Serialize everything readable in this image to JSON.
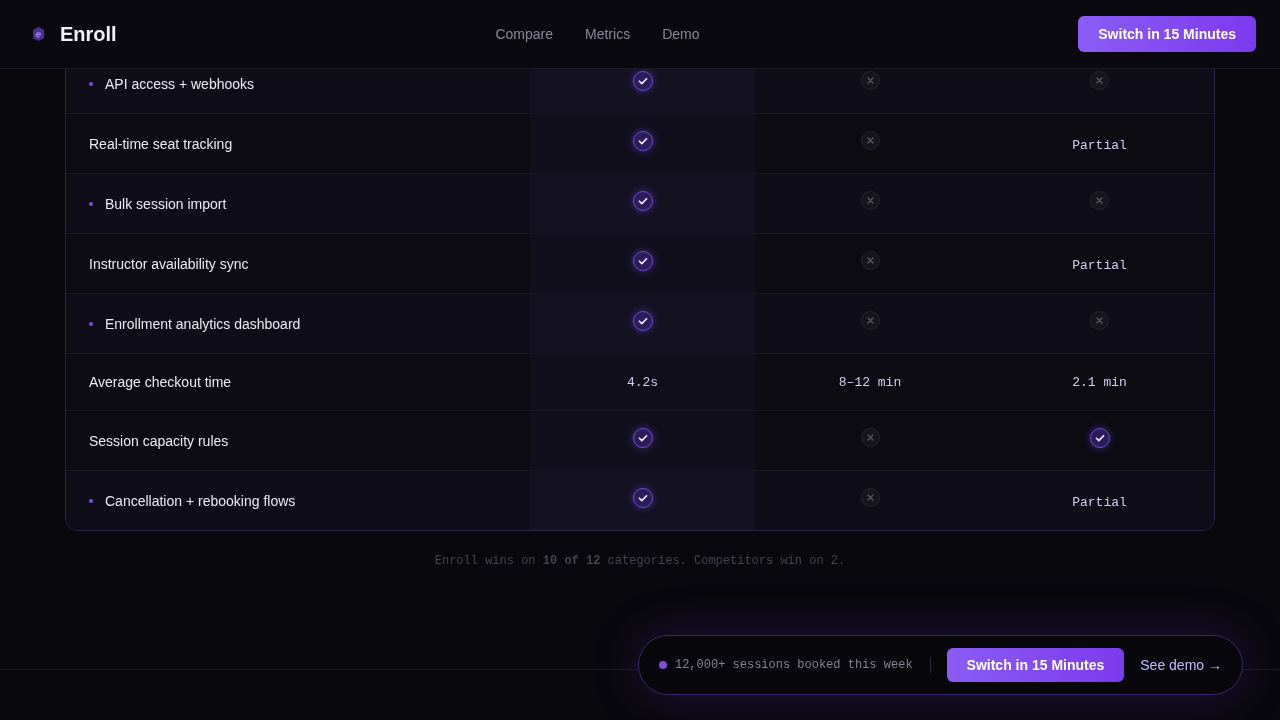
{
  "header": {
    "brand": "Enroll",
    "nav": [
      {
        "label": "Compare"
      },
      {
        "label": "Metrics"
      },
      {
        "label": "Demo"
      }
    ],
    "cta": "Switch in 15 Minutes"
  },
  "table": {
    "rows": [
      {
        "feature": "API access + webhooks",
        "highlighted": true,
        "cells": [
          {
            "kind": "check"
          },
          {
            "kind": "cross"
          },
          {
            "kind": "cross"
          }
        ]
      },
      {
        "feature": "Real-time seat tracking",
        "highlighted": false,
        "cells": [
          {
            "kind": "check"
          },
          {
            "kind": "cross"
          },
          {
            "kind": "text",
            "text": "Partial"
          }
        ]
      },
      {
        "feature": "Bulk session import",
        "highlighted": true,
        "cells": [
          {
            "kind": "check"
          },
          {
            "kind": "cross"
          },
          {
            "kind": "cross"
          }
        ]
      },
      {
        "feature": "Instructor availability sync",
        "highlighted": false,
        "cells": [
          {
            "kind": "check"
          },
          {
            "kind": "cross"
          },
          {
            "kind": "text",
            "text": "Partial"
          }
        ]
      },
      {
        "feature": "Enrollment analytics dashboard",
        "highlighted": true,
        "cells": [
          {
            "kind": "check"
          },
          {
            "kind": "cross"
          },
          {
            "kind": "cross"
          }
        ]
      },
      {
        "feature": "Average checkout time",
        "highlighted": false,
        "cells": [
          {
            "kind": "text",
            "text": "4.2s"
          },
          {
            "kind": "text",
            "text": "8–12 min"
          },
          {
            "kind": "text",
            "text": "2.1 min"
          }
        ]
      },
      {
        "feature": "Session capacity rules",
        "highlighted": false,
        "cells": [
          {
            "kind": "check"
          },
          {
            "kind": "cross"
          },
          {
            "kind": "check"
          }
        ]
      },
      {
        "feature": "Cancellation + rebooking flows",
        "highlighted": true,
        "cells": [
          {
            "kind": "check"
          },
          {
            "kind": "cross"
          },
          {
            "kind": "text",
            "text": "Partial"
          }
        ]
      }
    ]
  },
  "summary": "Enroll wins on **10 of 12** categories. Competitors win on 2.",
  "sticky_bar": {
    "status": "12,000+ sessions booked this week",
    "cta": "Switch in 15 Minutes",
    "link": "See demo →"
  }
}
